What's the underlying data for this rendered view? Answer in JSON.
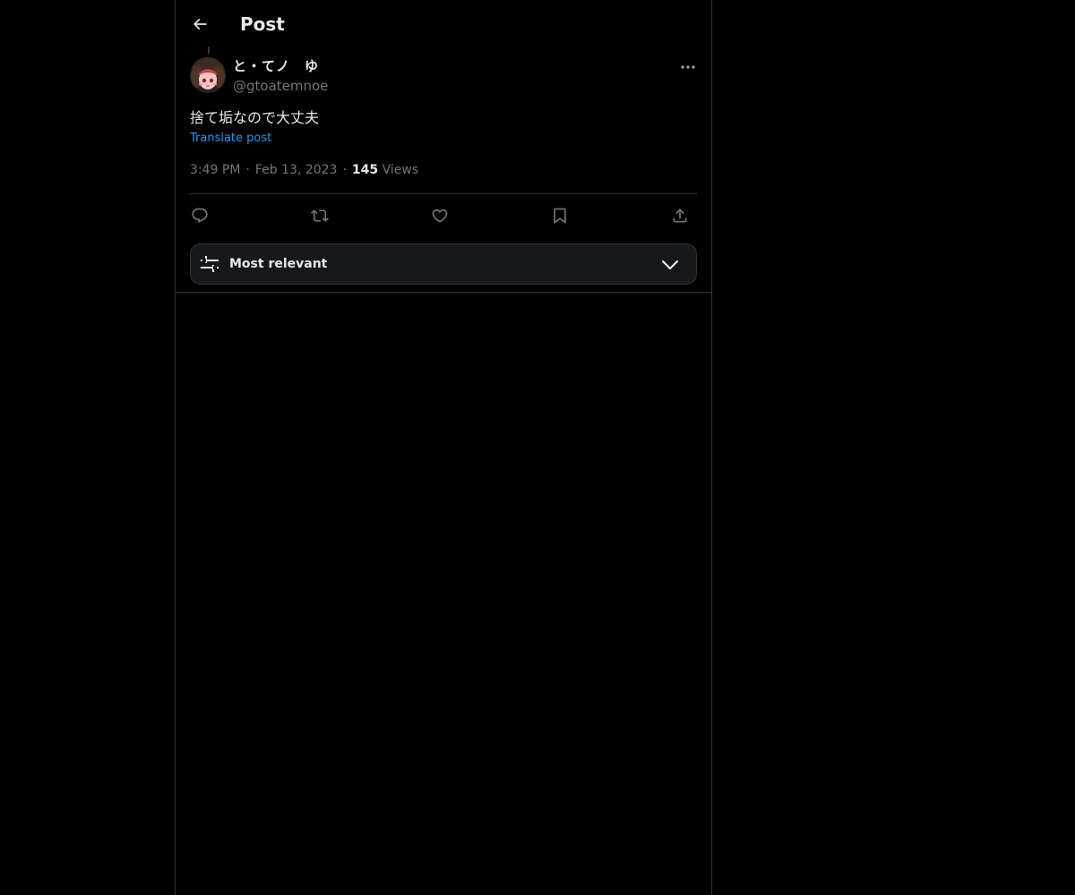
{
  "header": {
    "back_icon": "arrow-left-icon",
    "title": "Post"
  },
  "author": {
    "display_name": "と・てノ　ゆ",
    "handle": "@gtoatemnoe",
    "avatar": "avatar-image"
  },
  "post": {
    "text": "捨て垢なので大丈夫",
    "translate_label": "Translate post",
    "time": "3:49 PM",
    "date": "Feb 13, 2023",
    "views_count": "145",
    "views_label": "Views",
    "separator": "·"
  },
  "actions": [
    {
      "name": "reply",
      "icon": "reply-icon"
    },
    {
      "name": "repost",
      "icon": "repost-icon"
    },
    {
      "name": "like",
      "icon": "heart-icon"
    },
    {
      "name": "bookmark",
      "icon": "bookmark-icon"
    },
    {
      "name": "share",
      "icon": "share-icon"
    }
  ],
  "sort": {
    "label": "Most relevant",
    "icon": "sliders-icon",
    "chevron": "chevron-down-icon"
  },
  "colors": {
    "background": "#000000",
    "text_primary": "#e7e9ea",
    "text_secondary": "#71767b",
    "link": "#1d9bf0",
    "border": "#2f3336",
    "sort_bg": "#16181c"
  }
}
